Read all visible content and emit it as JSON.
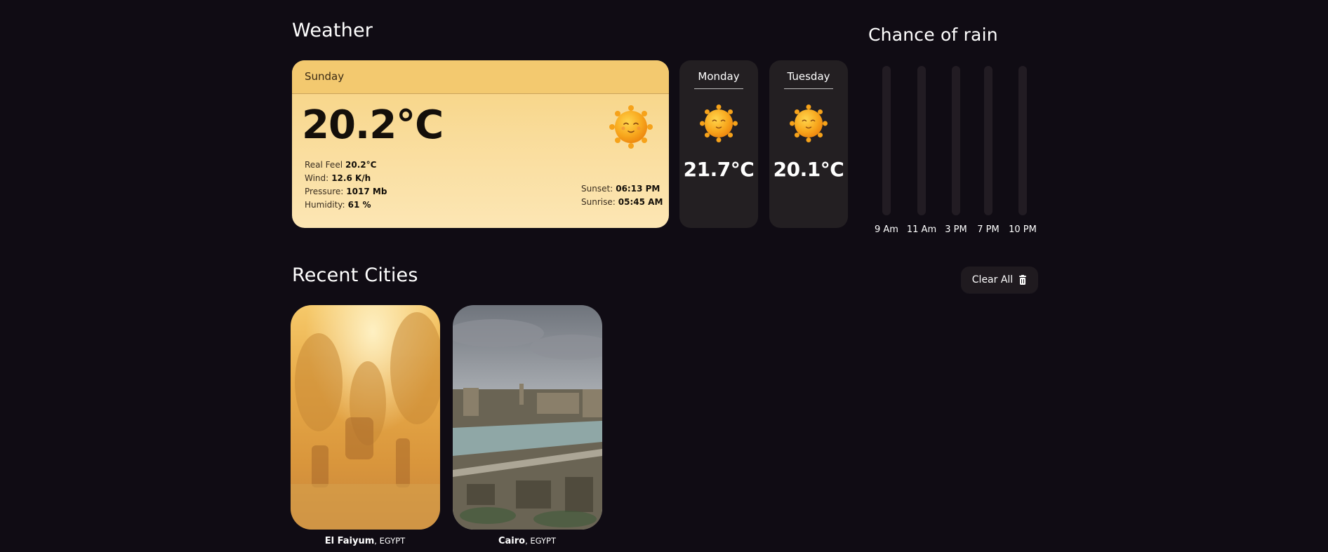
{
  "weather": {
    "title": "Weather",
    "today": {
      "day": "Sunday",
      "temp": "20.2°C",
      "real_feel_label": "Real Feel",
      "real_feel": "20.2°C",
      "wind_label": "Wind:",
      "wind": "12.6 K/h",
      "pressure_label": "Pressure:",
      "pressure": "1017 Mb",
      "humidity_label": "Humidity:",
      "humidity": "61 %",
      "sunset_label": "Sunset:",
      "sunset": "06:13 PM",
      "sunrise_label": "Sunrise:",
      "sunrise": "05:45 AM",
      "icon": "sun-icon"
    },
    "forecast": [
      {
        "day": "Monday",
        "temp": "21.7°C",
        "icon": "sun-icon"
      },
      {
        "day": "Tuesday",
        "temp": "20.1°C",
        "icon": "sun-icon"
      }
    ]
  },
  "rain": {
    "title": "Chance of rain",
    "accent_color": "#3b3340",
    "track_color": "#221c23"
  },
  "chart_data": {
    "type": "bar",
    "title": "Chance of rain",
    "categories": [
      "9 Am",
      "11 Am",
      "3 PM",
      "7 PM",
      "10 PM"
    ],
    "values": [
      0,
      0,
      0,
      0,
      0
    ],
    "ylim": [
      0,
      100
    ],
    "grid": false
  },
  "recent": {
    "title": "Recent Cities",
    "clear_label": "Clear All",
    "clear_icon": "trash-icon",
    "cities": [
      {
        "name": "El Faiyum",
        "country": ", EGYPT"
      },
      {
        "name": "Cairo",
        "country": ", EGYPT"
      }
    ]
  },
  "colors": {
    "background": "#100c14",
    "card_today": "#f7d27f",
    "card_forecast": "#231f22"
  }
}
